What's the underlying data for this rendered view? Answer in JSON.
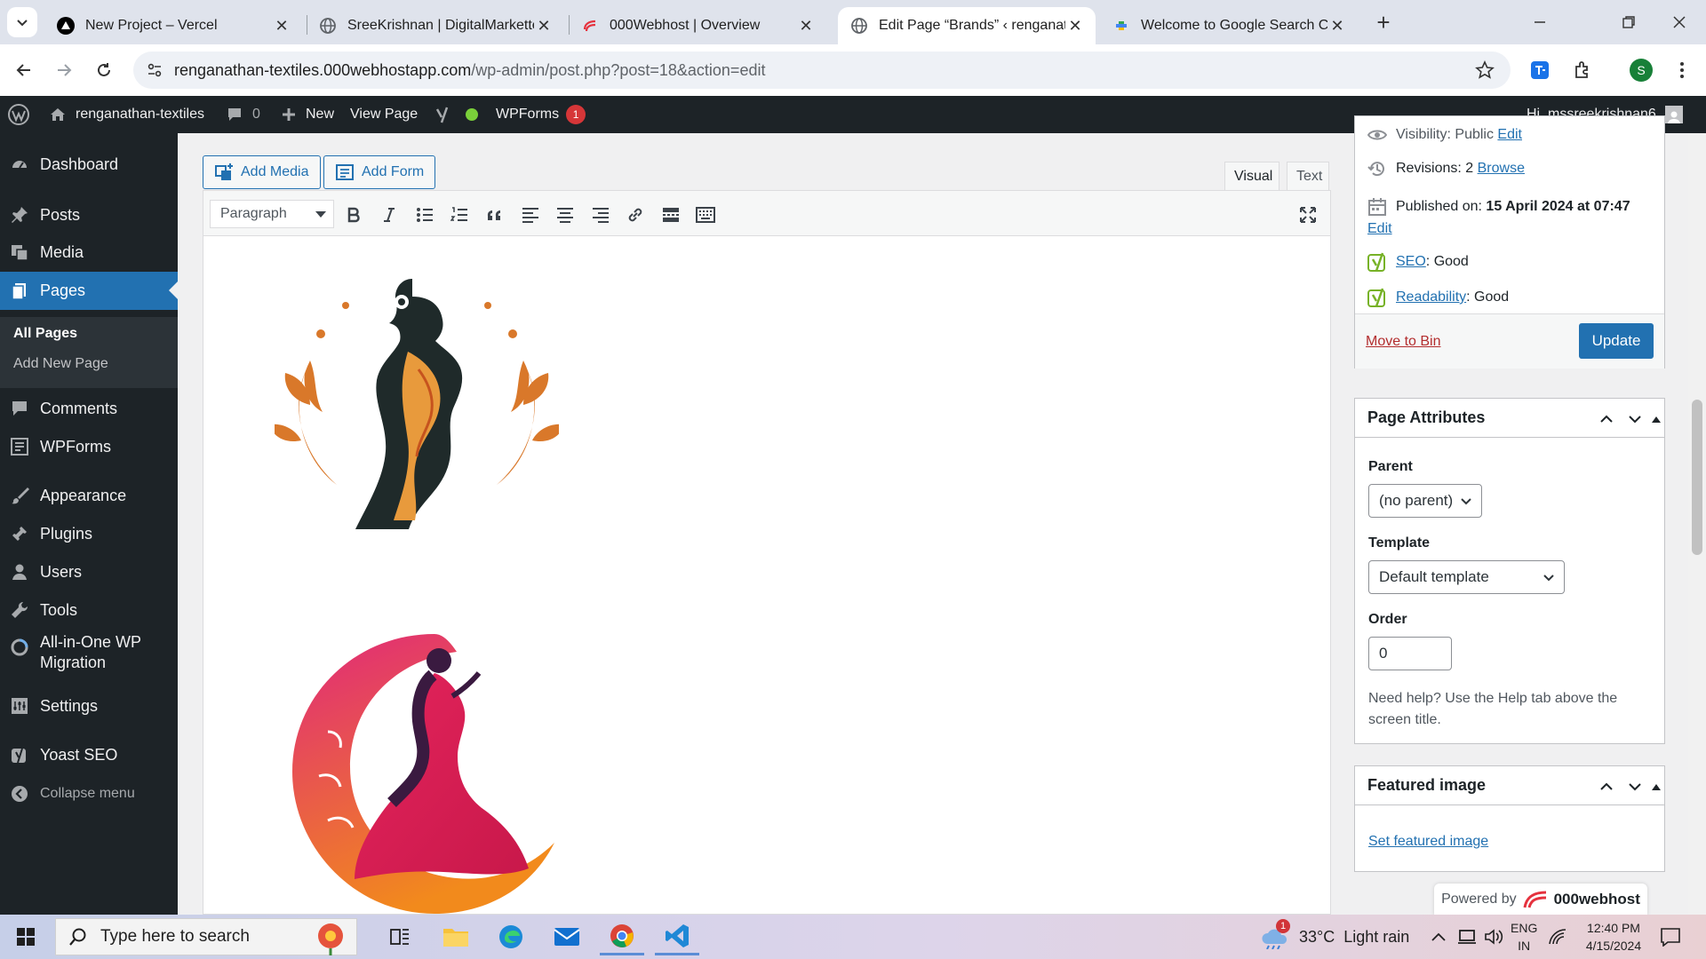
{
  "browser": {
    "tabs": [
      {
        "title": "New Project – Vercel",
        "close": "✕"
      },
      {
        "title": "SreeKrishnan | DigitalMarketter",
        "close": "✕"
      },
      {
        "title": "000Webhost | Overview",
        "close": "✕"
      },
      {
        "title": "Edit Page “Brands” ‹ renganathan-textiles",
        "close": "✕"
      },
      {
        "title": "Welcome to Google Search Console",
        "close": "✕"
      }
    ],
    "active_tab": 3,
    "new_tab": "+",
    "url_host": "renganathan-textiles.000webhostapp.com",
    "url_path": "/wp-admin/post.php?post=18&action=edit",
    "profile_initial": "S"
  },
  "adminbar": {
    "site_name": "renganathan-textiles",
    "comments_count": "0",
    "new_label": "New",
    "view_page": "View Page",
    "wpforms": "WPForms",
    "wpforms_badge": "1",
    "greeting": "Hi, mssreekrishnan6"
  },
  "sidebar": {
    "items": [
      {
        "label": "Dashboard",
        "icon": "dashboard-icon"
      },
      {
        "label": "Posts",
        "icon": "pin-icon"
      },
      {
        "label": "Media",
        "icon": "media-icon"
      },
      {
        "label": "Pages",
        "icon": "pages-icon"
      },
      {
        "label": "Comments",
        "icon": "comment-icon"
      },
      {
        "label": "WPForms",
        "icon": "forms-icon"
      },
      {
        "label": "Appearance",
        "icon": "brush-icon"
      },
      {
        "label": "Plugins",
        "icon": "plug-icon"
      },
      {
        "label": "Users",
        "icon": "user-icon"
      },
      {
        "label": "Tools",
        "icon": "wrench-icon"
      },
      {
        "label": "All-in-One WP Migration",
        "icon": "migration-icon"
      },
      {
        "label": "Settings",
        "icon": "settings-icon"
      },
      {
        "label": "Yoast SEO",
        "icon": "yoast-icon"
      },
      {
        "label": "Collapse menu",
        "icon": "collapse-icon"
      }
    ],
    "submenu": [
      "All Pages",
      "Add New Page"
    ]
  },
  "editor": {
    "add_media": "Add Media",
    "add_form": "Add Form",
    "tab_visual": "Visual",
    "tab_text": "Text",
    "format": "Paragraph"
  },
  "publish": {
    "visibility_partial": "Visibility: Public",
    "visibility_edit": "Edit",
    "revisions_label": "Revisions: 2",
    "revisions_link": "Browse",
    "published_label": "Published on:",
    "published_date": "15 April 2024 at 07:47",
    "published_edit": "Edit",
    "seo_link": "SEO",
    "seo_value": ": Good",
    "readability_link": "Readability",
    "readability_value": ": Good",
    "move_to_bin": "Move to Bin",
    "update": "Update"
  },
  "page_attributes": {
    "title": "Page Attributes",
    "parent_label": "Parent",
    "parent_value": "(no parent)",
    "template_label": "Template",
    "template_value": "Default template",
    "order_label": "Order",
    "order_value": "0",
    "help": "Need help? Use the Help tab above the screen title."
  },
  "featured_image": {
    "title": "Featured image",
    "link": "Set featured image"
  },
  "powered": {
    "label": "Powered by",
    "brand": "000webhost"
  },
  "taskbar": {
    "search_placeholder": "Type here to search",
    "weather_temp": "33°C",
    "weather_desc": "Light rain",
    "weather_badge": "1",
    "lang": "ENG",
    "region": "IN",
    "time": "12:40 PM",
    "date": "4/15/2024"
  },
  "colors": {
    "wp_blue": "#2271b1",
    "admin_dark": "#1d2327",
    "bin_red": "#b32d2e",
    "yoast_green": "#77b227"
  }
}
